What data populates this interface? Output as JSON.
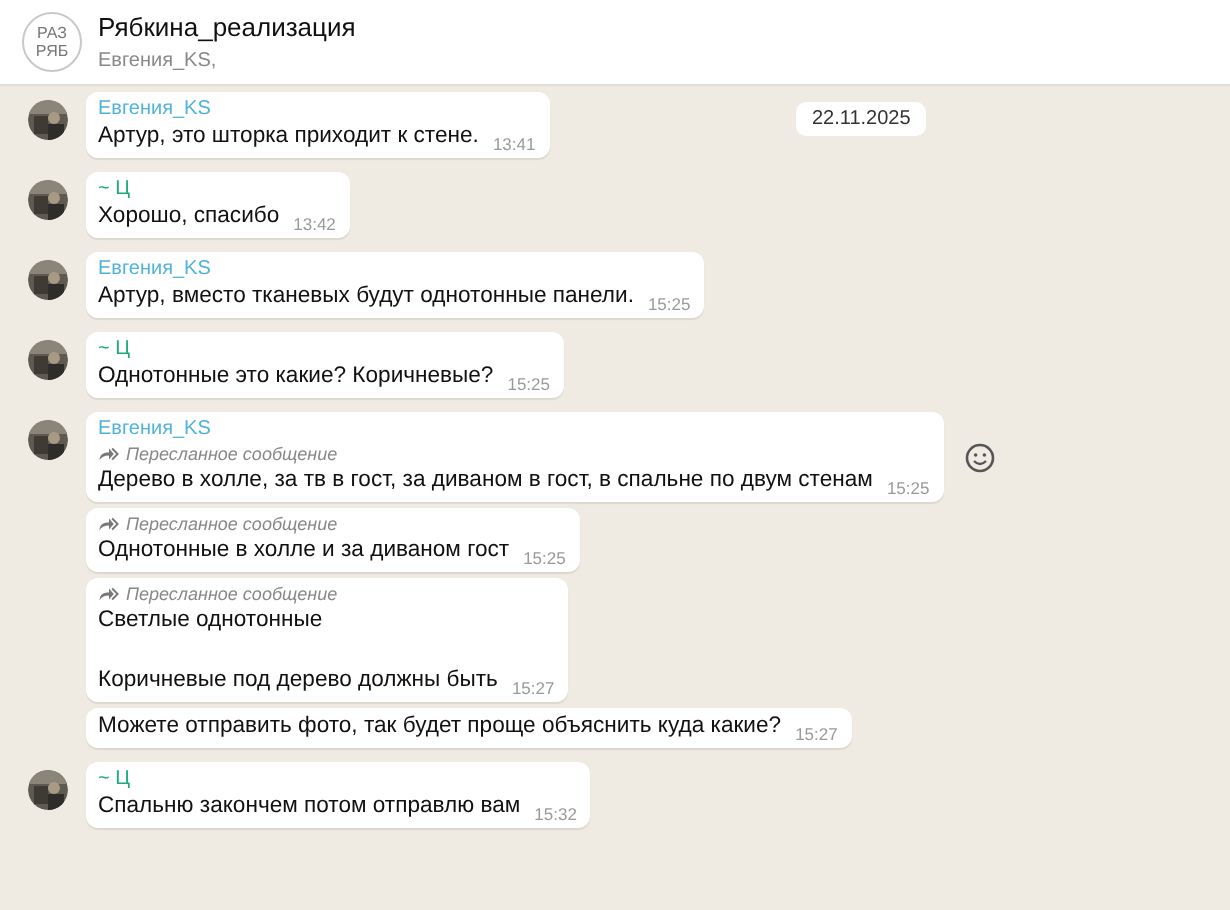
{
  "header": {
    "avatar_lines": [
      "РАЗ",
      "РЯБ"
    ],
    "title": "Рябкина_реализация",
    "subtitle": "Евгения_KS,"
  },
  "date_badge": "22.11.2025",
  "groups": [
    {
      "sender": "Евгения_KS",
      "color": "#4fb3d9",
      "messages": [
        {
          "text": "Артур, это шторка приходит к стене.",
          "time": "13:41",
          "reaction_button": false
        }
      ]
    },
    {
      "sender": "~ Ц",
      "color": "#1daa7e",
      "messages": [
        {
          "text": "Хорошо, спасибо",
          "time": "13:42",
          "reaction_button": false
        }
      ]
    },
    {
      "sender": "Евгения_KS",
      "color": "#4fb3d9",
      "messages": [
        {
          "text": "Артур, вместо тканевых будут однотонные панели.",
          "time": "15:25",
          "reaction_button": false
        }
      ]
    },
    {
      "sender": "~ Ц",
      "color": "#1daa7e",
      "messages": [
        {
          "text": "Однотонные это какие? Коричневые?",
          "time": "15:25",
          "reaction_button": false
        }
      ]
    },
    {
      "sender": "Евгения_KS",
      "color": "#4fb3d9",
      "messages": [
        {
          "forward_note": "Пересланное сообщение",
          "text": "Дерево в холле, за тв в гост, за диваном в гост, в спальне по двум стенам",
          "time": "15:25",
          "reaction_button": true
        },
        {
          "forward_note": "Пересланное сообщение",
          "text": "Однотонные в холле и за диваном гост",
          "time": "15:25",
          "reaction_button": false
        },
        {
          "forward_note": "Пересланное сообщение",
          "text": "Светлые однотонные\n\nКоричневые под дерево должны быть",
          "time": "15:27",
          "reaction_button": false
        },
        {
          "text": "Можете отправить фото, так будет проще объяснить куда какие?",
          "time": "15:27",
          "reaction_button": false
        }
      ]
    },
    {
      "sender": "~ Ц",
      "color": "#1daa7e",
      "messages": [
        {
          "text": "Спальню закончем потом отправлю вам",
          "time": "15:32",
          "reaction_button": false
        }
      ]
    }
  ]
}
